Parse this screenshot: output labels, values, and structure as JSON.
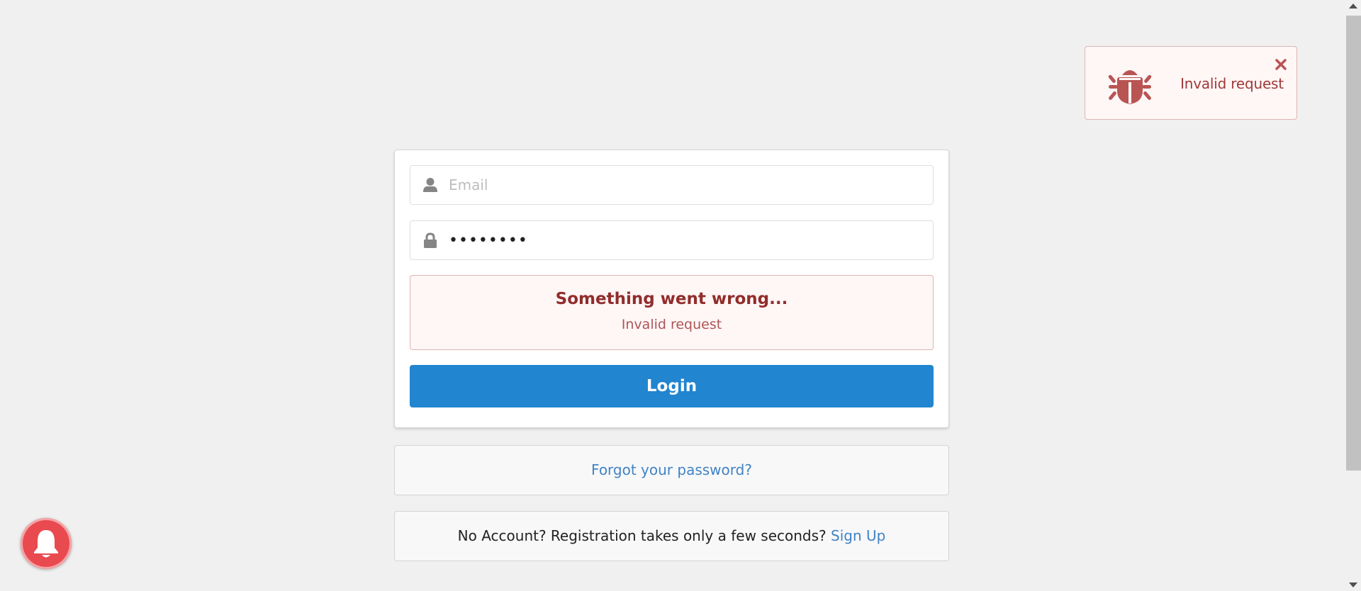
{
  "toast": {
    "message": "Invalid request",
    "icon": "bug-icon",
    "close_icon": "close-icon",
    "color": "#9f3a38",
    "background": "#fff6f6"
  },
  "login_form": {
    "email": {
      "placeholder": "Email",
      "value": "",
      "icon": "user-icon"
    },
    "password": {
      "value": "••••••••",
      "icon": "lock-icon"
    },
    "error": {
      "header": "Something went wrong...",
      "message": "Invalid request"
    },
    "login_button": {
      "label": "Login",
      "color": "#2185d0"
    }
  },
  "forgot_password": {
    "link_text": "Forgot your password?"
  },
  "signup": {
    "text": "No Account? Registration takes only a few seconds?",
    "link_text": "Sign Up"
  },
  "notification_bell": {
    "icon": "bell-icon",
    "color": "#e84a4f"
  }
}
